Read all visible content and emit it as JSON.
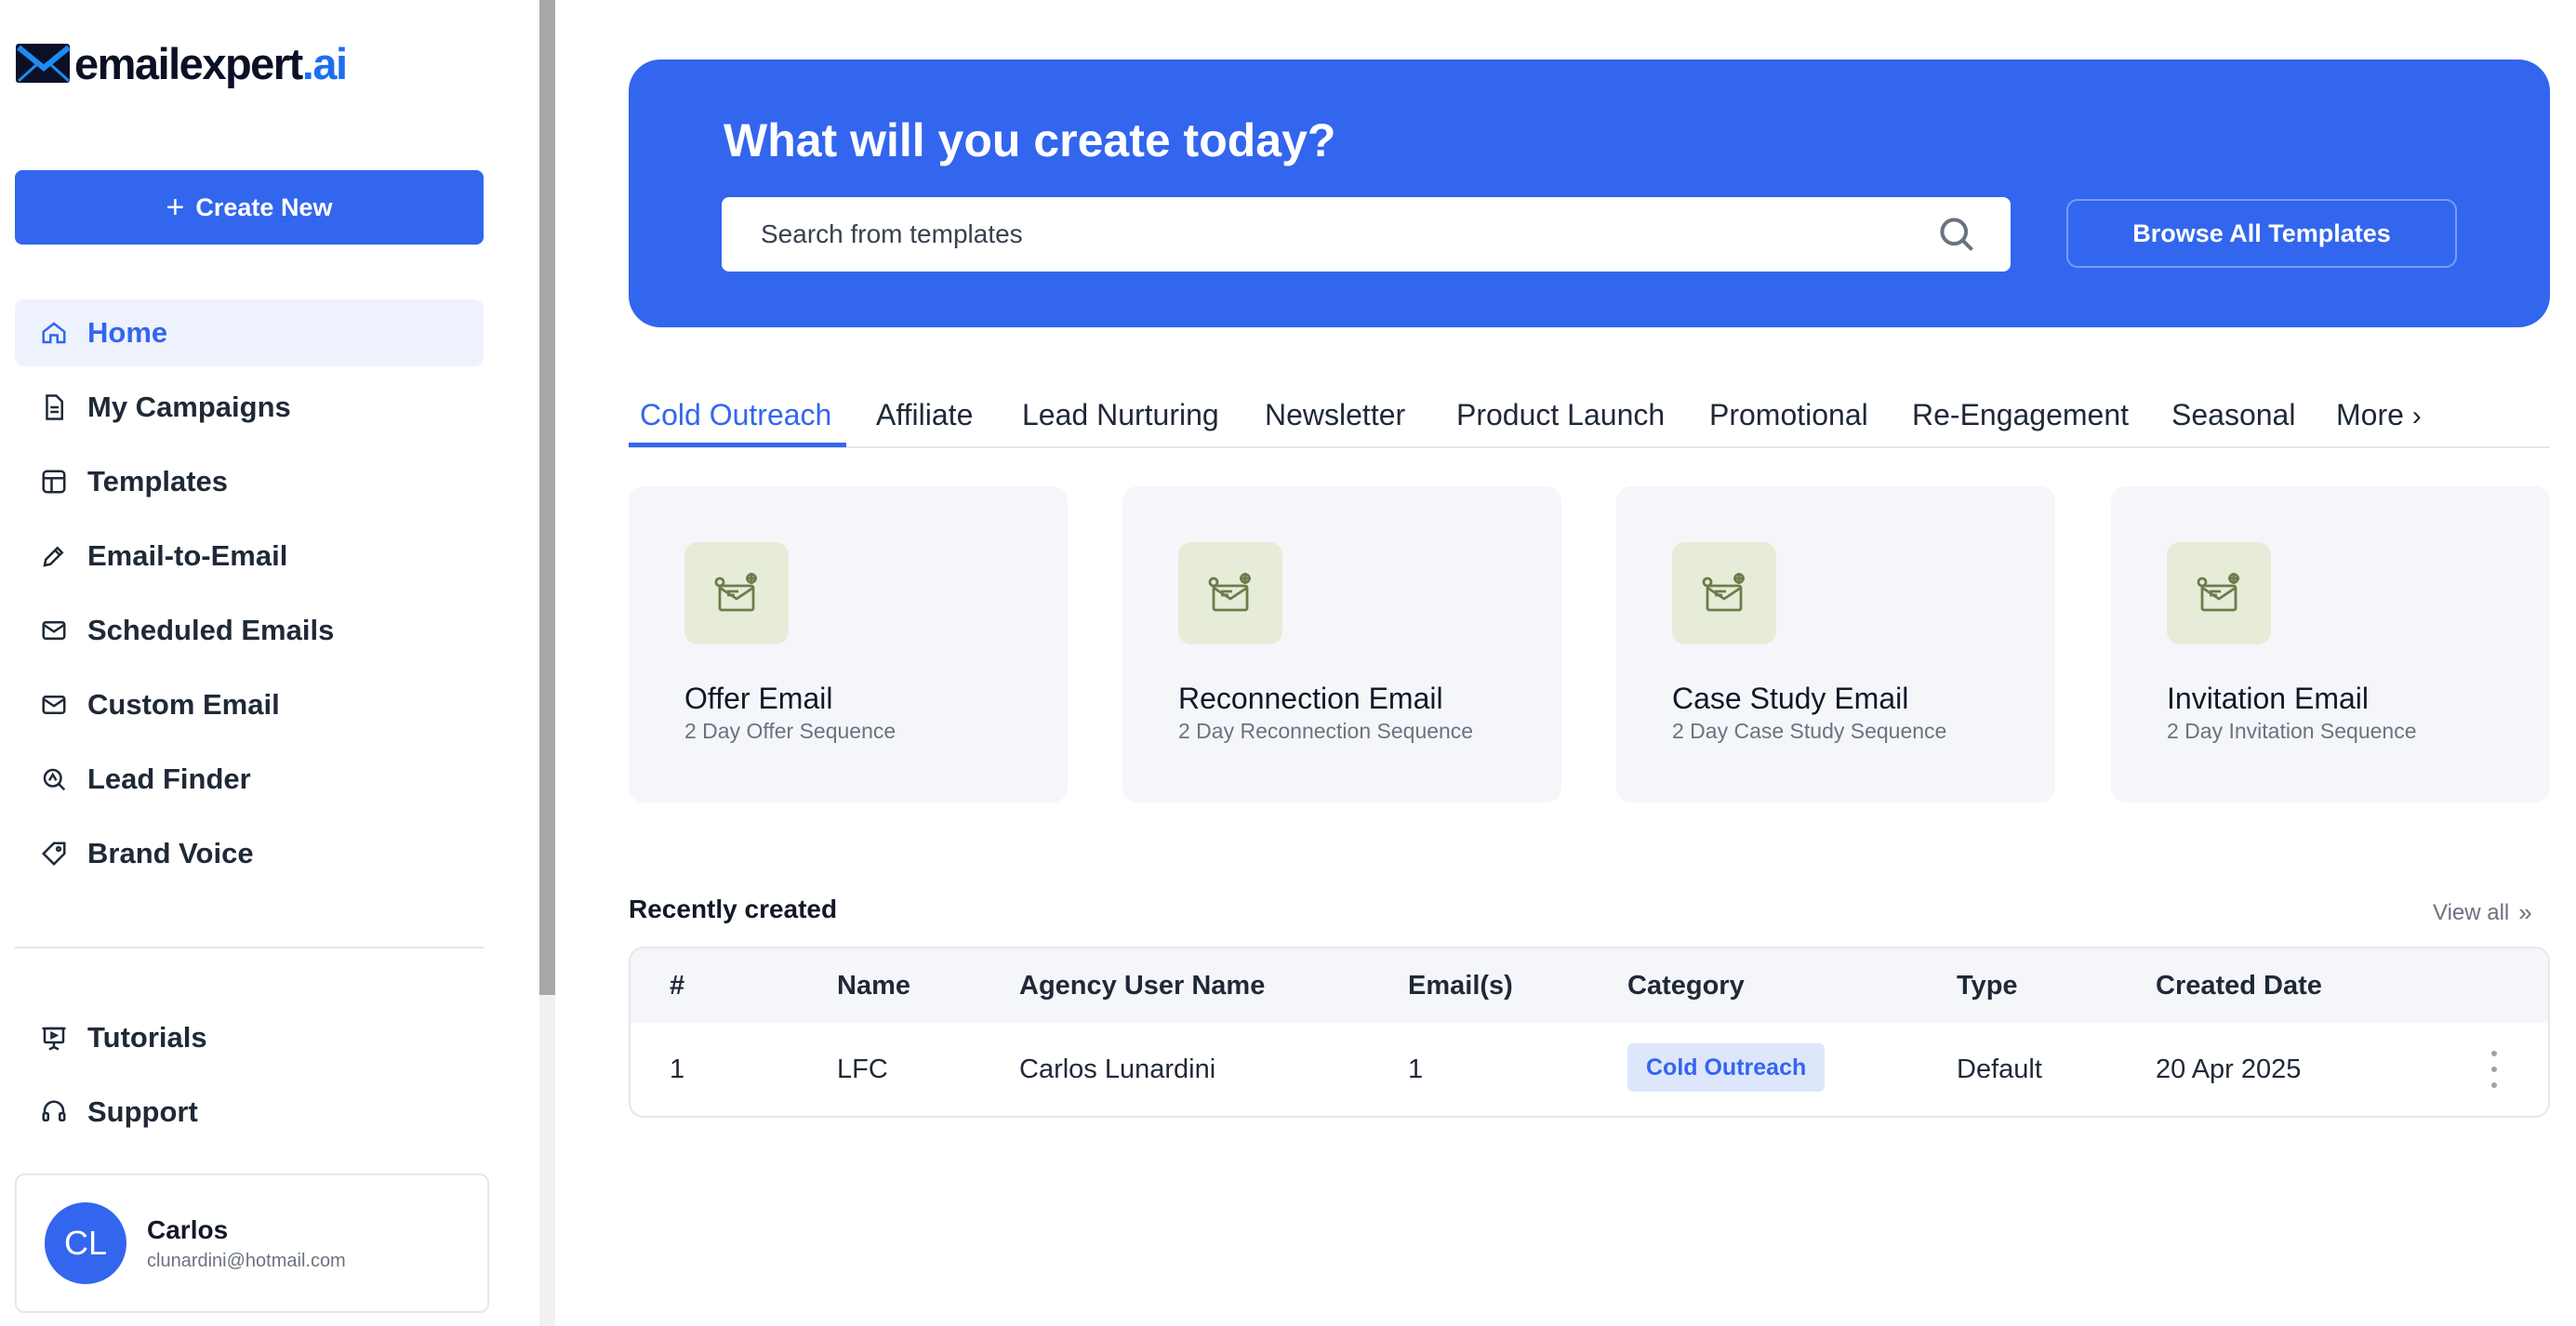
{
  "brand": {
    "name_main": "emailexpert",
    "name_suffix": ".ai"
  },
  "sidebar": {
    "create_label": "Create New",
    "items": [
      {
        "label": "Home",
        "icon": "home-icon",
        "active": true
      },
      {
        "label": "My Campaigns",
        "icon": "document-icon"
      },
      {
        "label": "Templates",
        "icon": "template-icon"
      },
      {
        "label": "Email-to-Email",
        "icon": "pen-icon"
      },
      {
        "label": "Scheduled Emails",
        "icon": "scheduled-mail-icon"
      },
      {
        "label": "Custom Email",
        "icon": "mail-icon"
      },
      {
        "label": "Lead Finder",
        "icon": "lead-search-icon"
      },
      {
        "label": "Brand Voice",
        "icon": "tag-icon"
      }
    ],
    "secondary": [
      {
        "label": "Tutorials",
        "icon": "presentation-icon"
      },
      {
        "label": "Support",
        "icon": "headset-icon"
      }
    ],
    "user": {
      "initials": "CL",
      "name": "Carlos",
      "email": "clunardini@hotmail.com"
    }
  },
  "hero": {
    "title": "What will you create today?",
    "search_placeholder": "Search from templates",
    "browse_label": "Browse All Templates"
  },
  "tabs": {
    "items": [
      "Cold Outreach",
      "Affiliate",
      "Lead Nurturing",
      "Newsletter",
      "Product Launch",
      "Promotional",
      "Re-Engagement",
      "Seasonal"
    ],
    "more": "More",
    "active": "Cold Outreach"
  },
  "cards": [
    {
      "title": "Offer Email",
      "subtitle": "2 Day Offer Sequence"
    },
    {
      "title": "Reconnection Email",
      "subtitle": "2 Day Reconnection Sequence"
    },
    {
      "title": "Case Study Email",
      "subtitle": "2 Day Case Study Sequence"
    },
    {
      "title": "Invitation Email",
      "subtitle": "2 Day Invitation Sequence"
    }
  ],
  "recent": {
    "title": "Recently created",
    "view_all": "View all",
    "columns": [
      "#",
      "Name",
      "Agency User Name",
      "Email(s)",
      "Category",
      "Type",
      "Created Date"
    ],
    "rows": [
      {
        "num": "1",
        "name": "LFC",
        "agency_user": "Carlos Lunardini",
        "emails": "1",
        "category": "Cold Outreach",
        "type": "Default",
        "created": "20 Apr 2025"
      }
    ]
  },
  "colors": {
    "accent": "#3366ee",
    "card_bg": "#f5f6fa",
    "icon_bg": "#e7ecd9",
    "badge_bg": "#dde6fb"
  }
}
